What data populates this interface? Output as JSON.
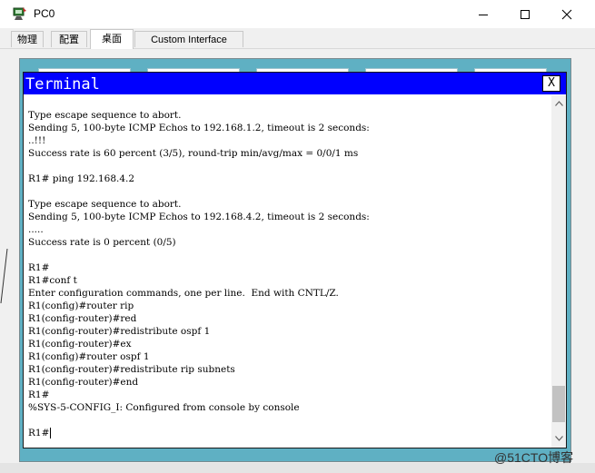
{
  "window": {
    "title": "PC0",
    "icon": "pc-app-icon",
    "controls": [
      "minimize-icon",
      "maximize-icon",
      "close-icon"
    ]
  },
  "tabs": [
    {
      "label": "物理",
      "active": false
    },
    {
      "label": "配置",
      "active": false
    },
    {
      "label": "桌面",
      "active": true
    },
    {
      "label": "Custom Interface",
      "active": false
    }
  ],
  "terminal": {
    "title": "Terminal",
    "close_label": "X",
    "lines": [
      "Type escape sequence to abort.",
      "Sending 5, 100-byte ICMP Echos to 192.168.1.2, timeout is 2 seconds:",
      "..!!!",
      "Success rate is 60 percent (3/5), round-trip min/avg/max = 0/0/1 ms",
      "",
      "R1# ping 192.168.4.2",
      "",
      "Type escape sequence to abort.",
      "Sending 5, 100-byte ICMP Echos to 192.168.4.2, timeout is 2 seconds:",
      ".....",
      "Success rate is 0 percent (0/5)",
      "",
      "R1#",
      "R1#conf t",
      "Enter configuration commands, one per line.  End with CNTL/Z.",
      "R1(config)#router rip",
      "R1(config-router)#red",
      "R1(config-router)#redistribute ospf 1",
      "R1(config-router)#ex",
      "R1(config)#router ospf 1",
      "R1(config-router)#redistribute rip subnets",
      "R1(config-router)#end",
      "R1#",
      "%SYS-5-CONFIG_I: Configured from console by console",
      "",
      "R1#"
    ]
  },
  "scrollbar": {
    "position_fraction": 0.9
  },
  "watermark": "@51CTO博客"
}
